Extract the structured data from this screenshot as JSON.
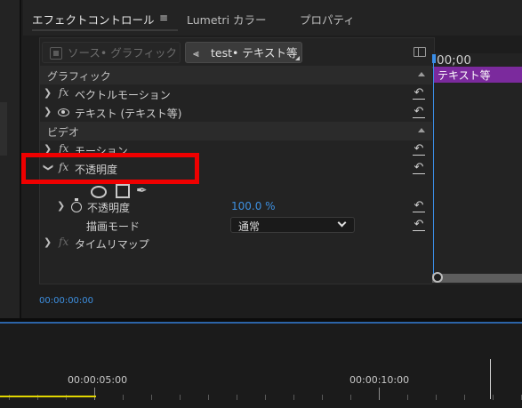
{
  "tabs": [
    {
      "label": "エフェクトコントロール",
      "menu": "≡",
      "active": true
    },
    {
      "label": "Lumetri カラー"
    },
    {
      "label": "プロパティ"
    }
  ],
  "source": {
    "inactive_label": "ソース• グラフィック",
    "active_label": "test• テキスト等",
    "active_icon": "⫷"
  },
  "sections": {
    "graphic": "グラフィック",
    "video": "ビデオ"
  },
  "effects": {
    "vector_motion": "ベクトルモーション",
    "text": "テキスト (テキスト等)",
    "motion": "モーション",
    "opacity": "不透明度",
    "time_remap": "タイムリマップ"
  },
  "opacity_params": {
    "opacity_label": "不透明度",
    "opacity_value": "100.0 %",
    "blend_label": "描画モード",
    "blend_value": "通常"
  },
  "mini_timeline": {
    "time": "00;00",
    "clip_label": "テキスト等"
  },
  "timecode": "00:00:00:00",
  "bottom_timeline": {
    "marks": [
      "00:00:05:00",
      "00:00:10:00"
    ]
  },
  "colors": {
    "accent": "#3d8fe0",
    "clip": "#7b2a9d",
    "highlight": "#ee0000"
  }
}
